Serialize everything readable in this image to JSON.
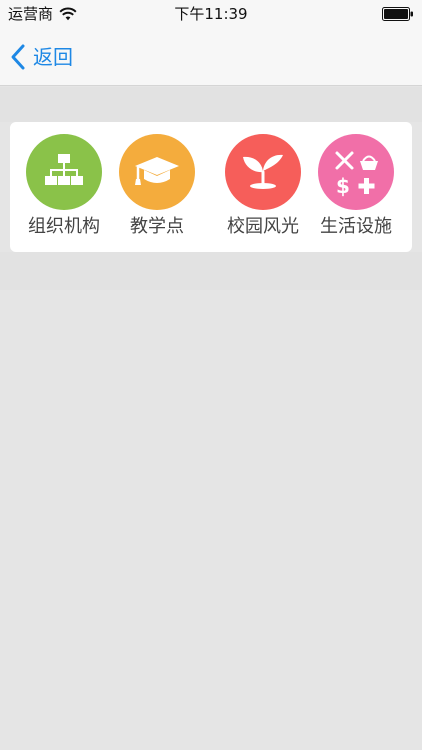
{
  "status_bar": {
    "carrier": "运营商",
    "time": "下午11:39"
  },
  "navbar": {
    "back_label": "返回"
  },
  "colors": {
    "accent": "#1e88e5",
    "icon_org": "#8ac249",
    "icon_teaching": "#f4ac3d",
    "icon_campus": "#f65e5a",
    "icon_facilities": "#f16fa8"
  },
  "grid": {
    "items": [
      {
        "label": "组织机构",
        "icon": "org-chart-icon"
      },
      {
        "label": "教学点",
        "icon": "graduation-cap-icon"
      },
      {
        "label": "校园风光",
        "icon": "sprout-icon"
      },
      {
        "label": "生活设施",
        "icon": "facilities-icon"
      }
    ]
  }
}
